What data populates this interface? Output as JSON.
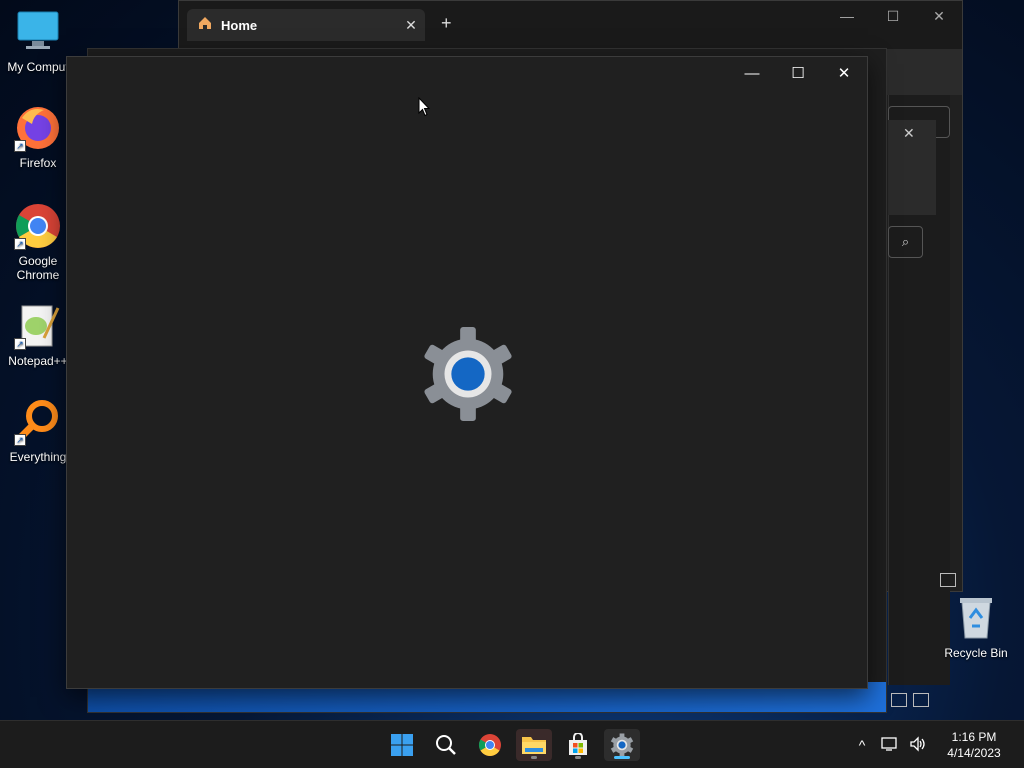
{
  "desktop": {
    "icons": [
      {
        "label": "My Comput"
      },
      {
        "label": "Firefox"
      },
      {
        "label": "Google Chrome"
      },
      {
        "label": "Notepad++"
      },
      {
        "label": "Everything"
      }
    ],
    "recycle_bin": {
      "label": "Recycle Bin"
    }
  },
  "explorer": {
    "tab_label": "Home",
    "tab_close": "✕",
    "new_tab": "+",
    "minimize": "—",
    "maximize": "☐",
    "close": "✕"
  },
  "right_panel": {
    "dialog_close": "✕",
    "search_glyph": "⌕"
  },
  "settings_window": {
    "minimize": "—",
    "maximize": "☐",
    "close": "✕",
    "splash_icon": "settings-gear-icon"
  },
  "taskbar": {
    "apps": [
      "start-icon",
      "search-icon",
      "chrome-icon",
      "file-explorer-icon",
      "microsoft-store-icon",
      "settings-icon"
    ],
    "tray": {
      "overflow": "^",
      "time": "1:16 PM",
      "date": "4/14/2023"
    }
  },
  "colors": {
    "accent": "#1a6fd1",
    "window_bg": "#202020",
    "taskbar_bg": "#1c1c1c"
  }
}
